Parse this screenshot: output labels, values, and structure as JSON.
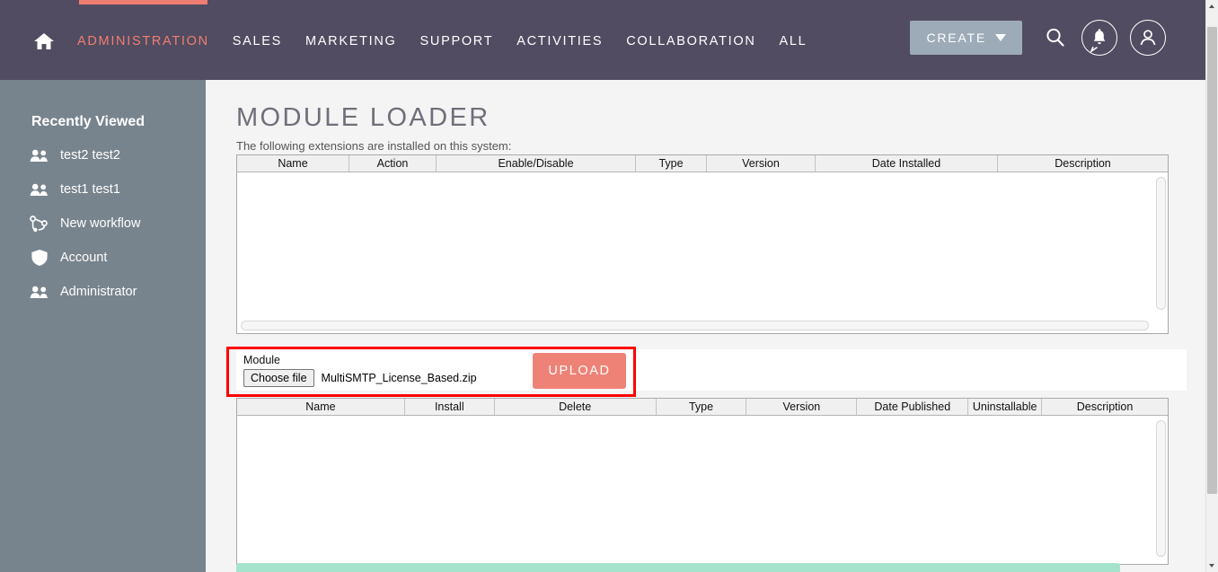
{
  "topnav": {
    "home_icon": "home-icon",
    "items": [
      {
        "label": "ADMINISTRATION",
        "active": true
      },
      {
        "label": "SALES",
        "active": false
      },
      {
        "label": "MARKETING",
        "active": false
      },
      {
        "label": "SUPPORT",
        "active": false
      },
      {
        "label": "ACTIVITIES",
        "active": false
      },
      {
        "label": "COLLABORATION",
        "active": false
      },
      {
        "label": "ALL",
        "active": false
      }
    ],
    "create_label": "CREATE",
    "search_icon": "search-icon",
    "notifications_icon": "bell-chat-icon",
    "profile_icon": "user-avatar-icon",
    "accent_color": "#f07d72",
    "bar_color": "#514c61",
    "create_button_color": "#9dabb8"
  },
  "sidebar": {
    "title": "Recently Viewed",
    "background_color": "#78848d",
    "items": [
      {
        "label": "test2 test2",
        "icon": "contacts-icon"
      },
      {
        "label": "test1 test1",
        "icon": "contacts-icon"
      },
      {
        "label": "New workflow",
        "icon": "workflow-icon"
      },
      {
        "label": "Account",
        "icon": "shield-icon"
      },
      {
        "label": "Administrator",
        "icon": "contacts-icon"
      }
    ]
  },
  "main": {
    "page_title": "MODULE LOADER",
    "intro_text": "The following extensions are installed on this system:",
    "installed_table": {
      "columns": [
        "Name",
        "Action",
        "Enable/Disable",
        "Type",
        "Version",
        "Date Installed",
        "Description"
      ],
      "rows": []
    },
    "upload": {
      "module_label": "Module",
      "choose_file_label": "Choose file",
      "file_name": "MultiSMTP_License_Based.zip",
      "upload_label": "UPLOAD",
      "upload_button_color": "#ee8277",
      "highlight_color": "#fe0000"
    },
    "available_table": {
      "columns": [
        "Name",
        "Install",
        "Delete",
        "Type",
        "Version",
        "Date Published",
        "Uninstallable",
        "Description"
      ],
      "rows": []
    },
    "notification_bar_color": "#a5e3cd"
  }
}
